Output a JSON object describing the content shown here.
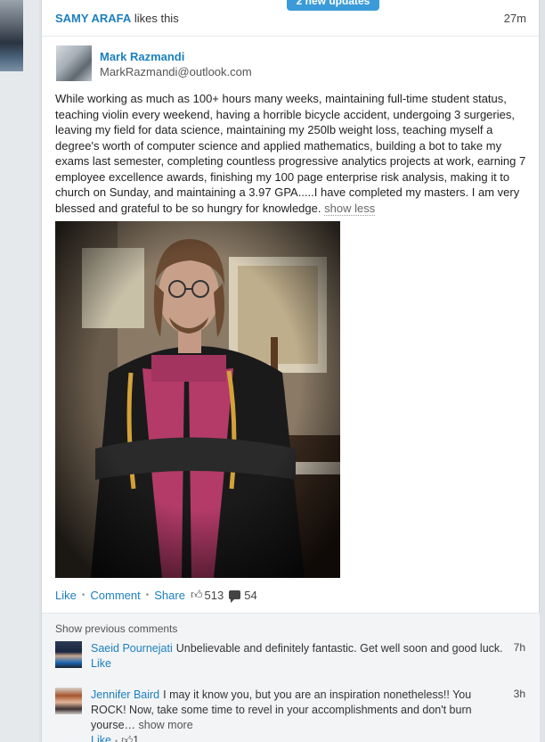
{
  "banner": {
    "label": "2 new updates"
  },
  "activity": {
    "actor": "SAMY ARAFA",
    "verb": " likes this",
    "time": "27m"
  },
  "post": {
    "author_name": "Mark Razmandi",
    "author_email": "MarkRazmandi@outlook.com",
    "body": "While working as much as 100+ hours many weeks, maintaining full-time student status, teaching violin every weekend, having a horrible bicycle accident, undergoing 3 surgeries, leaving my field for data science, maintaining my 250lb weight loss, teaching myself a degree's worth of computer science and applied mathematics, building a bot to take my exams last semester, completing countless progressive analytics projects at work, earning 7 employee excellence awards, finishing my 100 page enterprise risk analysis, making it to church on Sunday, and maintaining a 3.97 GPA.....I have completed my masters. I am very blessed and grateful to be so hungry for knowledge.",
    "show_less": "show less"
  },
  "actions": {
    "like": "Like",
    "comment": "Comment",
    "share": "Share",
    "like_count": "513",
    "comment_count": "54"
  },
  "comments": {
    "show_previous": "Show previous comments",
    "items": [
      {
        "name": "Saeid Pournejati",
        "text": "Unbelievable and definitely fantastic. Get well soon and good luck.",
        "time": "7h",
        "like": "Like"
      },
      {
        "name": "Jennifer Baird",
        "text": "I may it know you, but you are an inspiration nonetheless!! You ROCK! Now, take some time to revel in your accomplishments and don't burn yourse…",
        "more": "show more",
        "time": "3h",
        "like": "Like",
        "likes": "1"
      }
    ]
  },
  "colors": {
    "link": "#1c7fbe",
    "banner": "#3b9bd8"
  },
  "icons": [
    "thumbs-up-icon",
    "comment-bubble-icon"
  ]
}
